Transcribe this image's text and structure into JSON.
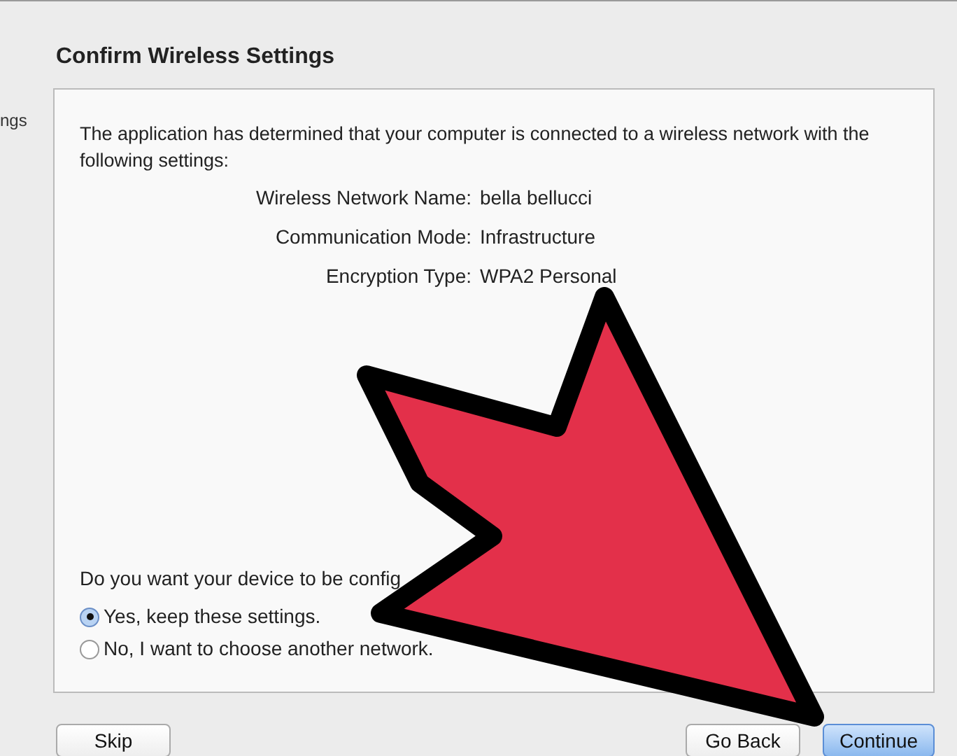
{
  "sidebar": {
    "items": [
      {
        "label": "ngs"
      }
    ]
  },
  "heading": "Confirm Wireless Settings",
  "intro": "The application has determined that your computer is connected to a wireless network with the following settings:",
  "settings": [
    {
      "label": "Wireless Network Name:",
      "value": "bella bellucci"
    },
    {
      "label": "Communication Mode:",
      "value": "Infrastructure"
    },
    {
      "label": "Encryption Type:",
      "value": "WPA2 Personal"
    }
  ],
  "question": "Do you want your device to be config",
  "options": [
    {
      "label": "Yes, keep these settings.",
      "selected": true
    },
    {
      "label": "No, I want to choose another network.",
      "selected": false
    }
  ],
  "buttons": [
    {
      "label": "Skip",
      "kind": "plain"
    },
    {
      "label": "Go Back",
      "kind": "plain"
    },
    {
      "label": "Continue",
      "kind": "default"
    }
  ]
}
